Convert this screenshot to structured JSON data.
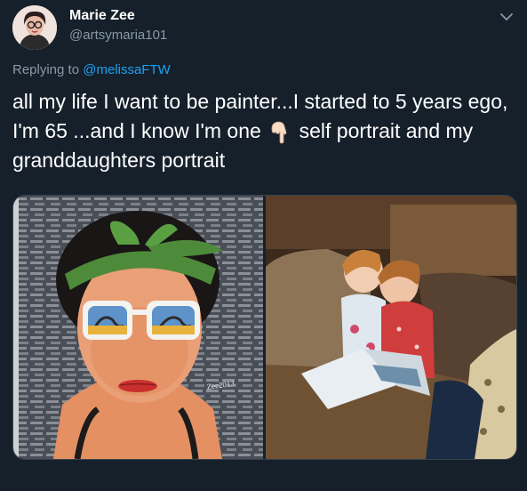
{
  "tweet": {
    "author_name": "Marie Zee",
    "author_handle": "@artsymaria101",
    "reply_prefix": "Replying to",
    "reply_mention": "@melissaFTW",
    "text_part1": "all my life I want to be painter...I started to 5 years ego, I'm 65 ...and I know I'm one",
    "text_emoji": "pointing-down-hand-icon",
    "text_part2": "self portrait and my granddaughters portrait"
  },
  "media": {
    "items": [
      {
        "name": "self-portrait-painting",
        "signature": "Zee2013"
      },
      {
        "name": "granddaughters-portrait-painting"
      }
    ]
  },
  "colors": {
    "background": "#15202b",
    "text": "#ffffff",
    "muted": "#8899a6",
    "link": "#1da1f2",
    "border": "#38444d"
  }
}
